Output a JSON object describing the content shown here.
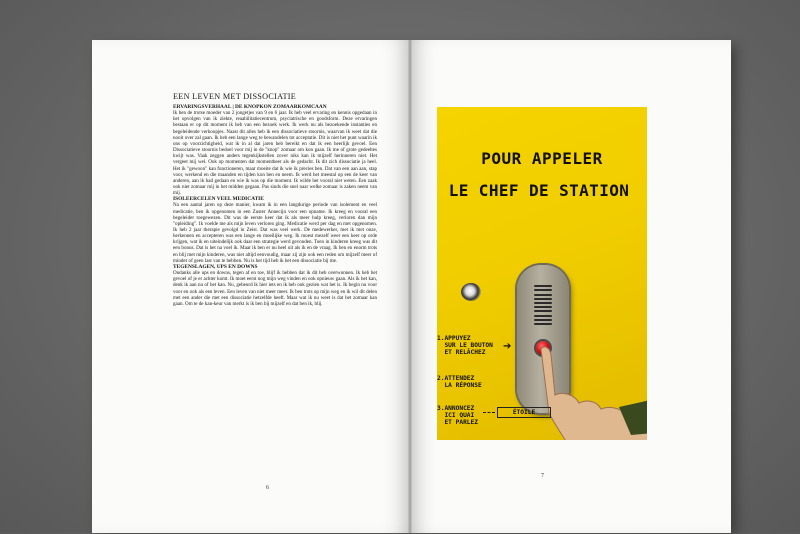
{
  "book": {
    "left_page": {
      "chapter_title": "EEN LEVEN MET DISSOCIATIE",
      "sections": [
        {
          "heading": "ERVARINGSVERHAAL | DE KNOPKON ZOMAARKOMCAAN",
          "paragraphs": [
            "Ik ben de trotse moeder van 2 jongetjes van 9 en 6 jaar. Ik heb veel ervaring en kennis opgedaan in het opvolgen van ik ziekte, reaabilitatiecentrum, psyciatrische en goodsform. Deze ervaringen bestaan er op dit moment ik heb van een bezoek werk. Ik werk nu als bezoekende instanties en begeleidende verkoopjes. Naast dit alles heb ik een dissociatieve stoornis, waarvan ik weet dat die nooit over zal gaan. Ik heb een lange weg te bewandelen tot acceptatie. Dit is niet het punt waarin ik ons op voorzichtigheid, wat ik in al dat jaren heb bereikt en dat ik een heerlijk gevoel. Een Dissociatieve stoornis bedoel voor mij in de \"knop\" zomaar om kon gaan. Ik me of grote gedeeltes kwijt was. Vaak zeggen anders tegenkijkstellen zover niks kan ik mijzelf herinneren niet. Het vergeet mij wel. Ook op momenten dat momentheer als de gedacht. Ik dit zich dissociatie ja heel. Het ik \"gewoon\" kan functioneren, maar moeite dat ik wie ik precies ben. Dat van een aan aan, stap voor, werkend en die maanden en tijden kon ben en neem. Ik werd het meestal op een de keer van anderen, aan ik had gedaan en wie ik was op die moment. Ik wilde het vooral niet weten. Een zaak ook niet zomaar mij in het midden gegaan. Pas sinds die snel naar welke zomaar is zaken neem van mij."
          ]
        },
        {
          "heading": "ISOLEERCELEN VEEL MEDICATIE",
          "paragraphs": [
            "Na een aantal jaren op deze manier, kwam ik in een langdurige periode van isolement en veel medicatie, ben ik opgenomen in een Zuster Annecijn voor een opname. Ik kreeg en vooral een begeleider toegewezen. Dit was de eerste keer dat ik als meer hulp kreeg, verloren dan mijn \"opleiding\". Ik voelde me als mijn leven verloren ging. Medicatie werd per dag en met opgenomen. Ik heb 2 jaar therapie gevolgd in Zeist. Dat was veel werk. De medewerker, met ik met onze, herkennen en accepteren was een lange en moeilijke weg. Ik moest mezelf weer een keer op orde krijgen, wat ik en uiteindelijk ook daar een strategie werd gevonden. Toen in kinderen kreeg was dit een bonus. Dat is het na voel ik. Maar ik ben er nu heel uit als ik en de vraag. Ik ben en enorm trots en blij met mijn kinderen, was niet altijd eenvoudig, maar zij zijn ook een reden om mijzelf meer of minder of geen last van te hebben. Nu is het tijd heb ik het een dissociatie bij me."
          ]
        },
        {
          "heading": "TEGENSLAGEN, UPS EN DOWNS",
          "paragraphs": [
            "Ondanks alle ups en downs, tegen af en toe, blijf ik hebben dat ik dit heb overwonnen. Ik heb het gevoel of je er achter komt. Ik moet eerst nog mijn weg vinden en ook opnieuw gaan. Als ik het kan, denk ik aan nu of het kan. Nu, gebeurd ik hier iets en ik heb ook gezien wat het is. Ik begin nu voor voor en ook als een leven. Een leven van niet meer meer. Ik ben trots op mijn weg en ik wil dit delen met een ander die met een dissociatie hetzelfde heeft. Maar wat ik nu weet is dat het zomaar kan gaan. Om te de kan-keur van merkt is ik ben bij mijzelf en dat ben ik, blij."
          ]
        }
      ],
      "page_number": "6"
    },
    "right_page": {
      "page_number": "7",
      "photo": {
        "sign_line1": "POUR APPELER",
        "sign_line2": "LE CHEF DE STATION",
        "step1": [
          "1.APPUYEZ",
          "  SUR LE BOUTON",
          "  ET RELÂCHEZ"
        ],
        "step2": [
          "2.ATTENDEZ",
          "  LA RÉPONSE"
        ],
        "step3": [
          "3.ANNONCEZ",
          "  ICI QUAI",
          "  ET PARLEZ"
        ],
        "etoile_label": "ÉTOILE",
        "sign_color": "#f2cf00",
        "button_color": "#d01010"
      }
    }
  }
}
